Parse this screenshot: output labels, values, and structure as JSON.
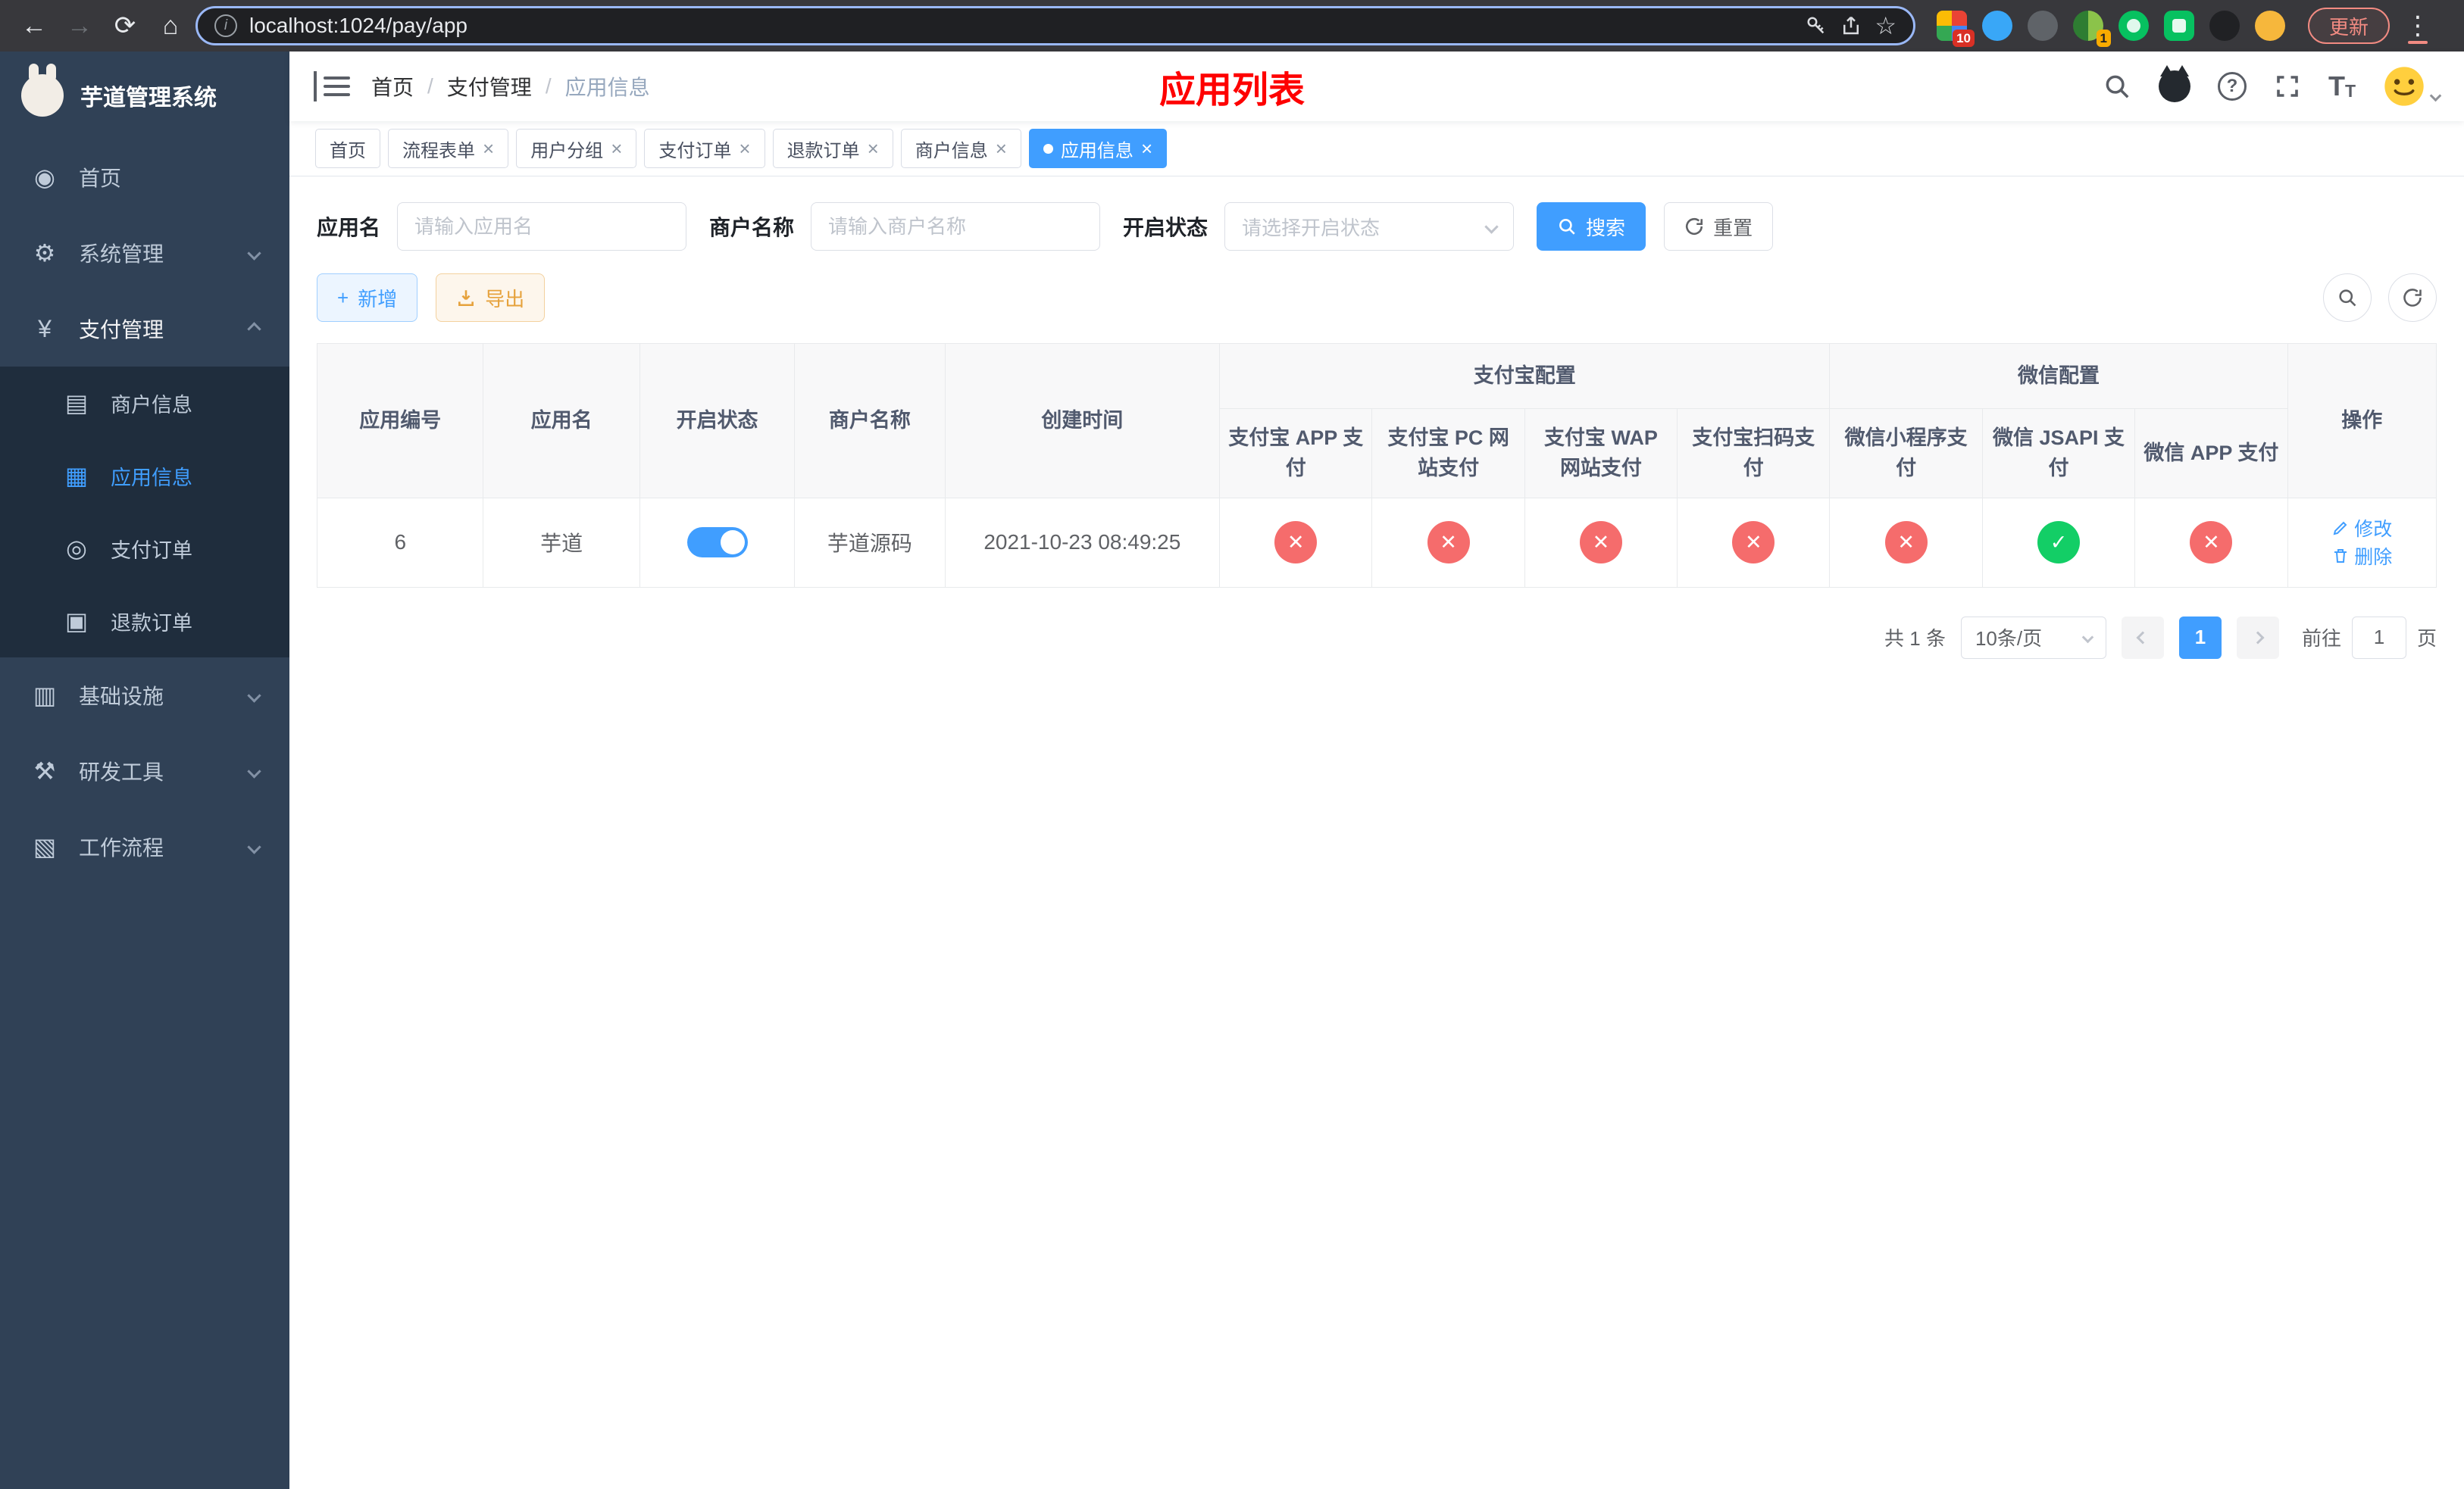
{
  "colors": {
    "accent": "#409eff",
    "danger": "#f56c6c",
    "success": "#13ce66",
    "title_red": "#fe0000",
    "sidebar_bg": "#304156",
    "submenu_bg": "#1f2d3d"
  },
  "browser": {
    "url": "localhost:1024/pay/app",
    "update_label": "更新",
    "ext_badge_1": "10",
    "ext_badge_2": "1"
  },
  "sidebar": {
    "app_title": "芋道管理系统",
    "items": [
      {
        "label": "首页"
      },
      {
        "label": "系统管理"
      },
      {
        "label": "支付管理"
      },
      {
        "label": "基础设施"
      },
      {
        "label": "研发工具"
      },
      {
        "label": "工作流程"
      }
    ],
    "payment_submenu": [
      {
        "label": "商户信息"
      },
      {
        "label": "应用信息",
        "active": true
      },
      {
        "label": "支付订单"
      },
      {
        "label": "退款订单"
      }
    ]
  },
  "header": {
    "breadcrumb": [
      "首页",
      "支付管理",
      "应用信息"
    ],
    "page_title": "应用列表"
  },
  "tabs": [
    {
      "label": "首页",
      "closable": false
    },
    {
      "label": "流程表单",
      "closable": true
    },
    {
      "label": "用户分组",
      "closable": true
    },
    {
      "label": "支付订单",
      "closable": true
    },
    {
      "label": "退款订单",
      "closable": true
    },
    {
      "label": "商户信息",
      "closable": true
    },
    {
      "label": "应用信息",
      "closable": true,
      "active": true
    }
  ],
  "filters": {
    "app_name_label": "应用名",
    "app_name_placeholder": "请输入应用名",
    "merchant_label": "商户名称",
    "merchant_placeholder": "请输入商户名称",
    "status_label": "开启状态",
    "status_placeholder": "请选择开启状态",
    "search_label": "搜索",
    "reset_label": "重置"
  },
  "toolbar": {
    "add_label": "新增",
    "export_label": "导出"
  },
  "table": {
    "headers": {
      "app_id": "应用编号",
      "app_name": "应用名",
      "status": "开启状态",
      "merchant": "商户名称",
      "create_time": "创建时间",
      "alipay_group": "支付宝配置",
      "wechat_group": "微信配置",
      "alipay_cols": [
        "支付宝 APP 支付",
        "支付宝 PC 网站支付",
        "支付宝 WAP 网站支付",
        "支付宝扫码支付"
      ],
      "wechat_cols": [
        "微信小程序支付",
        "微信 JSAPI 支付",
        "微信 APP 支付"
      ],
      "actions": "操作"
    },
    "rows": [
      {
        "app_id": "6",
        "app_name": "芋道",
        "enabled": true,
        "merchant": "芋道源码",
        "create_time": "2021-10-23 08:49:25",
        "channels": [
          "x",
          "x",
          "x",
          "x",
          "x",
          "check",
          "x"
        ],
        "edit_label": "修改",
        "delete_label": "删除"
      }
    ]
  },
  "pagination": {
    "total": "共 1 条",
    "page_size": "10条/页",
    "current_page": "1",
    "goto_prefix": "前往",
    "goto_value": "1",
    "goto_suffix": "页"
  }
}
